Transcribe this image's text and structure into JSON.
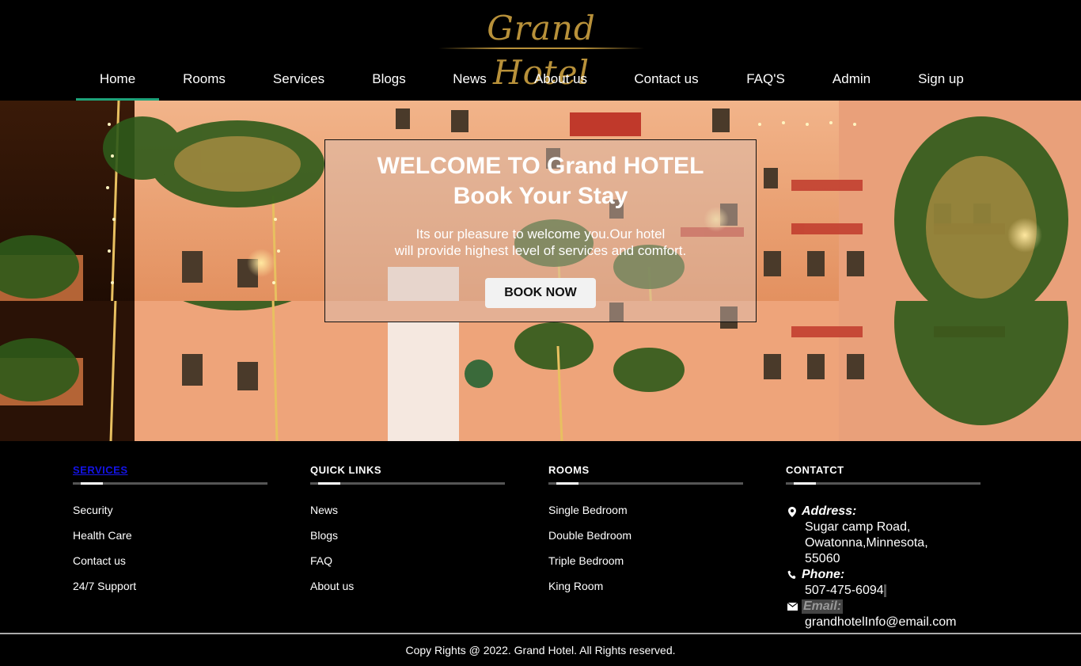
{
  "logo": {
    "text": "Grand Hotel"
  },
  "nav": {
    "items": [
      "Home",
      "Rooms",
      "Services",
      "Blogs",
      "News",
      "About us",
      "Contact us",
      "FAQ'S",
      "Admin",
      "Sign up"
    ],
    "active": "Home",
    "active_color": "#1ea37a"
  },
  "hero": {
    "title_line1": "WELCOME TO Grand HOTEL",
    "title_line2": "Book Your Stay",
    "subtitle_line1": "Its our pleasure to welcome you.Our hotel",
    "subtitle_line2": "will provide highest level of services and comfort.",
    "button": "BOOK NOW"
  },
  "footer": {
    "services": {
      "title": "SERVICES",
      "items": [
        "Security",
        "Health Care",
        "Contact us",
        "24/7 Support"
      ]
    },
    "quick_links": {
      "title": "QUICK LINKS",
      "items": [
        "News",
        "Blogs",
        "FAQ",
        "About us"
      ]
    },
    "rooms": {
      "title": "ROOMS",
      "items": [
        "Single Bedroom",
        "Double Bedroom",
        "Triple Bedroom",
        "King Room"
      ]
    },
    "contact": {
      "title": "CONTATCT",
      "address_label": "Address:",
      "address_line1": "Sugar camp Road, Owatonna,Minnesota,",
      "address_line2": "55060",
      "phone_label": "Phone:",
      "phone": "507-475-6094",
      "email_label": "Email:",
      "email": "grandhotelInfo@email.com"
    },
    "copyright": "Copy Rights @ 2022. Grand Hotel. All Rights reserved."
  },
  "colors": {
    "logo_gold": "#b8913a",
    "services_link": "#1414e6"
  }
}
